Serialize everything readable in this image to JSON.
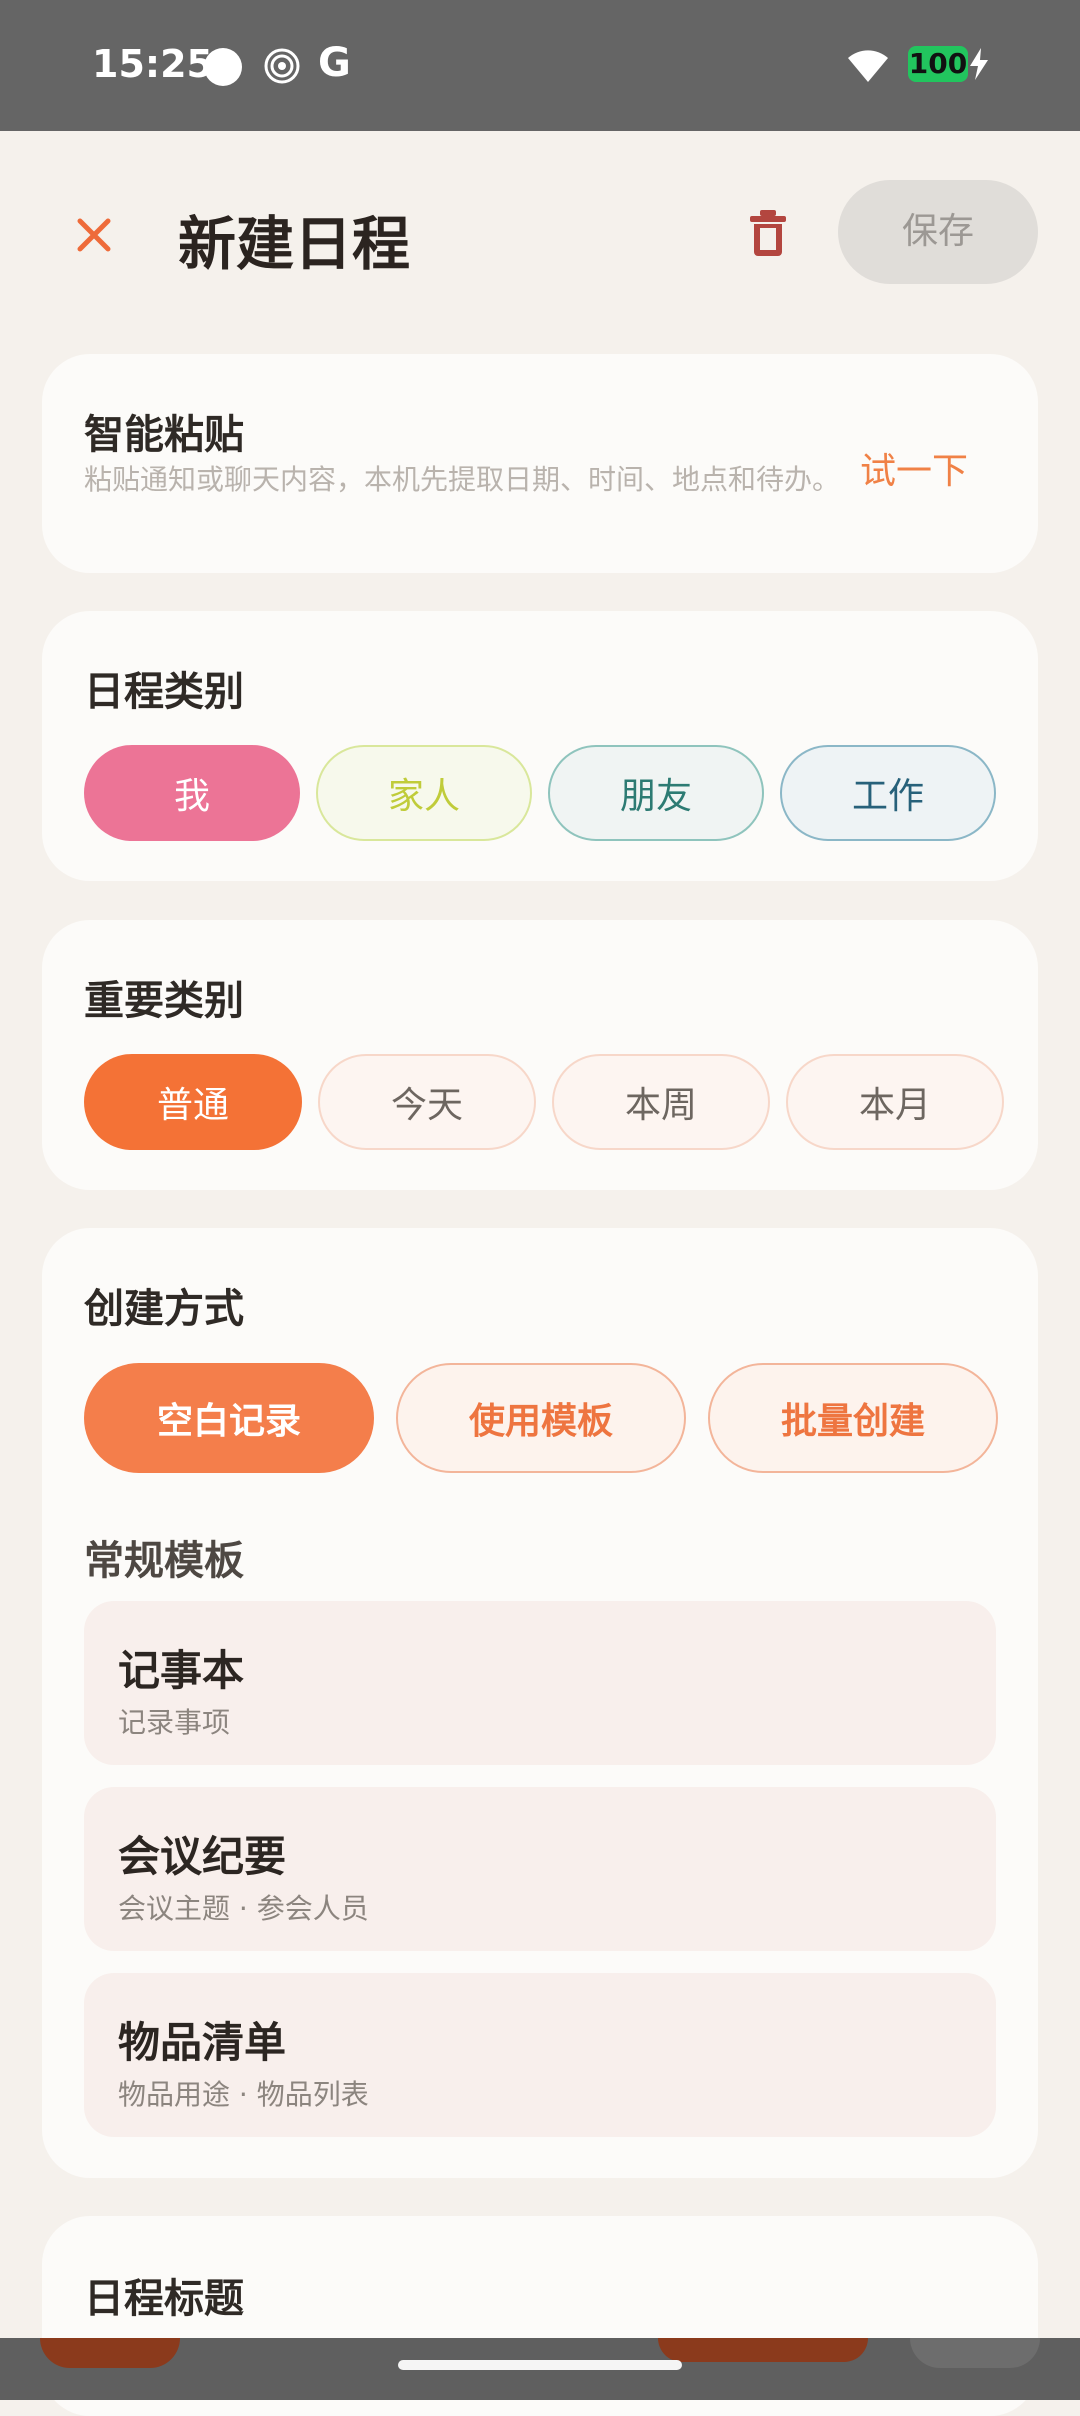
{
  "status_bar": {
    "time": "15:25",
    "battery": "100",
    "icons": [
      "circle-icon",
      "spiral-icon",
      "google-icon",
      "wifi-icon",
      "battery-icon",
      "charging-icon"
    ]
  },
  "header": {
    "title": "新建日程",
    "close_icon": "close-icon",
    "delete_icon": "trash-icon",
    "save_label": "保存"
  },
  "smart_paste": {
    "title": "智能粘贴",
    "description": "粘贴通知或聊天内容，本机先提取日期、时间、地点和待办。",
    "action_label": "试一下"
  },
  "schedule_category": {
    "title": "日程类别",
    "options": [
      "我",
      "家人",
      "朋友",
      "工作"
    ],
    "selected": "我"
  },
  "importance_category": {
    "title": "重要类别",
    "options": [
      "普通",
      "今天",
      "本周",
      "本月"
    ],
    "selected": "普通"
  },
  "creation_mode": {
    "title": "创建方式",
    "options": [
      "空白记录",
      "使用模板",
      "批量创建"
    ],
    "selected": "空白记录",
    "templates_title": "常规模板",
    "templates": [
      {
        "title": "记事本",
        "subtitle": "记录事项"
      },
      {
        "title": "会议纪要",
        "subtitle": "会议主题 · 参会人员"
      },
      {
        "title": "物品清单",
        "subtitle": "物品用途 · 物品列表"
      }
    ]
  },
  "schedule_title_section": {
    "title": "日程标题"
  },
  "colors": {
    "accent": "#f47236",
    "background": "#f5f1ec",
    "card": "#fcfbf9",
    "me_pink": "#ec7496"
  }
}
